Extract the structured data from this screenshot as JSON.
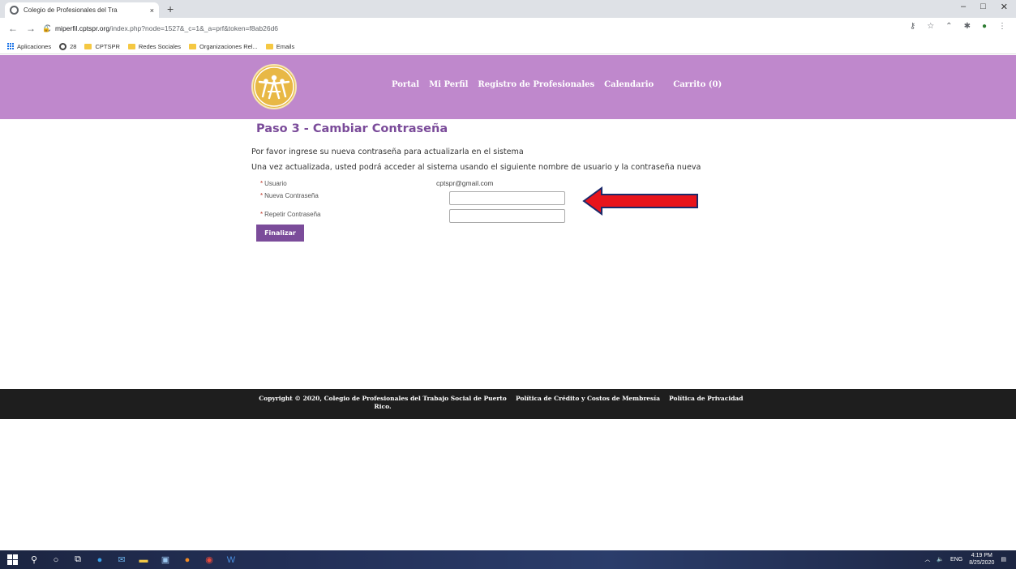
{
  "browser": {
    "tab_title": "Colegio de Profesionales del Tra",
    "tab_close": "×",
    "new_tab": "+",
    "url_domain": "miperfil.cptspr.org",
    "url_path": "/index.php?node=1527&_c=1&_a=prf&token=f8ab26d6",
    "window_controls": [
      "–",
      "□",
      "✕"
    ],
    "bookmarks": [
      {
        "label": "Aplicaciones",
        "icon": "apps-icon"
      },
      {
        "label": "28",
        "icon": "globe-icon"
      },
      {
        "label": "CPTSPR",
        "icon": "folder-icon"
      },
      {
        "label": "Redes Sociales",
        "icon": "folder-icon"
      },
      {
        "label": "Organizaciones Rel...",
        "icon": "folder-icon"
      },
      {
        "label": "Emails",
        "icon": "folder-icon"
      }
    ]
  },
  "site": {
    "menu": [
      "Portal",
      "Mi Perfil",
      "Registro de Profesionales",
      "Calendario"
    ],
    "cart": "Carrito (0)",
    "header_color": "#bf88cc",
    "accent_color": "#7b4c9a"
  },
  "form": {
    "title": "Paso 3 - Cambiar Contraseña",
    "intro": "Por favor ingrese su nueva contraseña para actualizarla en el sistema",
    "note": "Una vez actualizada, usted podrá acceder al sistema usando el siguiente nombre de usuario y la contraseña nueva",
    "required_mark": "*",
    "username_label": "Usuario",
    "username_value": "cptspr@gmail.com",
    "new_password_label": "Nueva Contraseña",
    "new_password_value": "",
    "repeat_password_label": "Repetir Contraseña",
    "repeat_password_value": "",
    "submit_label": "Finalizar"
  },
  "footer": {
    "copyright": "Copyright © 2020, Colegio de Profesionales del Trabajo Social de Puerto Rico.",
    "link1": "Política de Crédito y Costos de Membresía",
    "link2": "Política de Privacidad"
  },
  "taskbar": {
    "tray_lang": "ENG",
    "time": "4:19 PM",
    "date": "8/25/2020"
  }
}
